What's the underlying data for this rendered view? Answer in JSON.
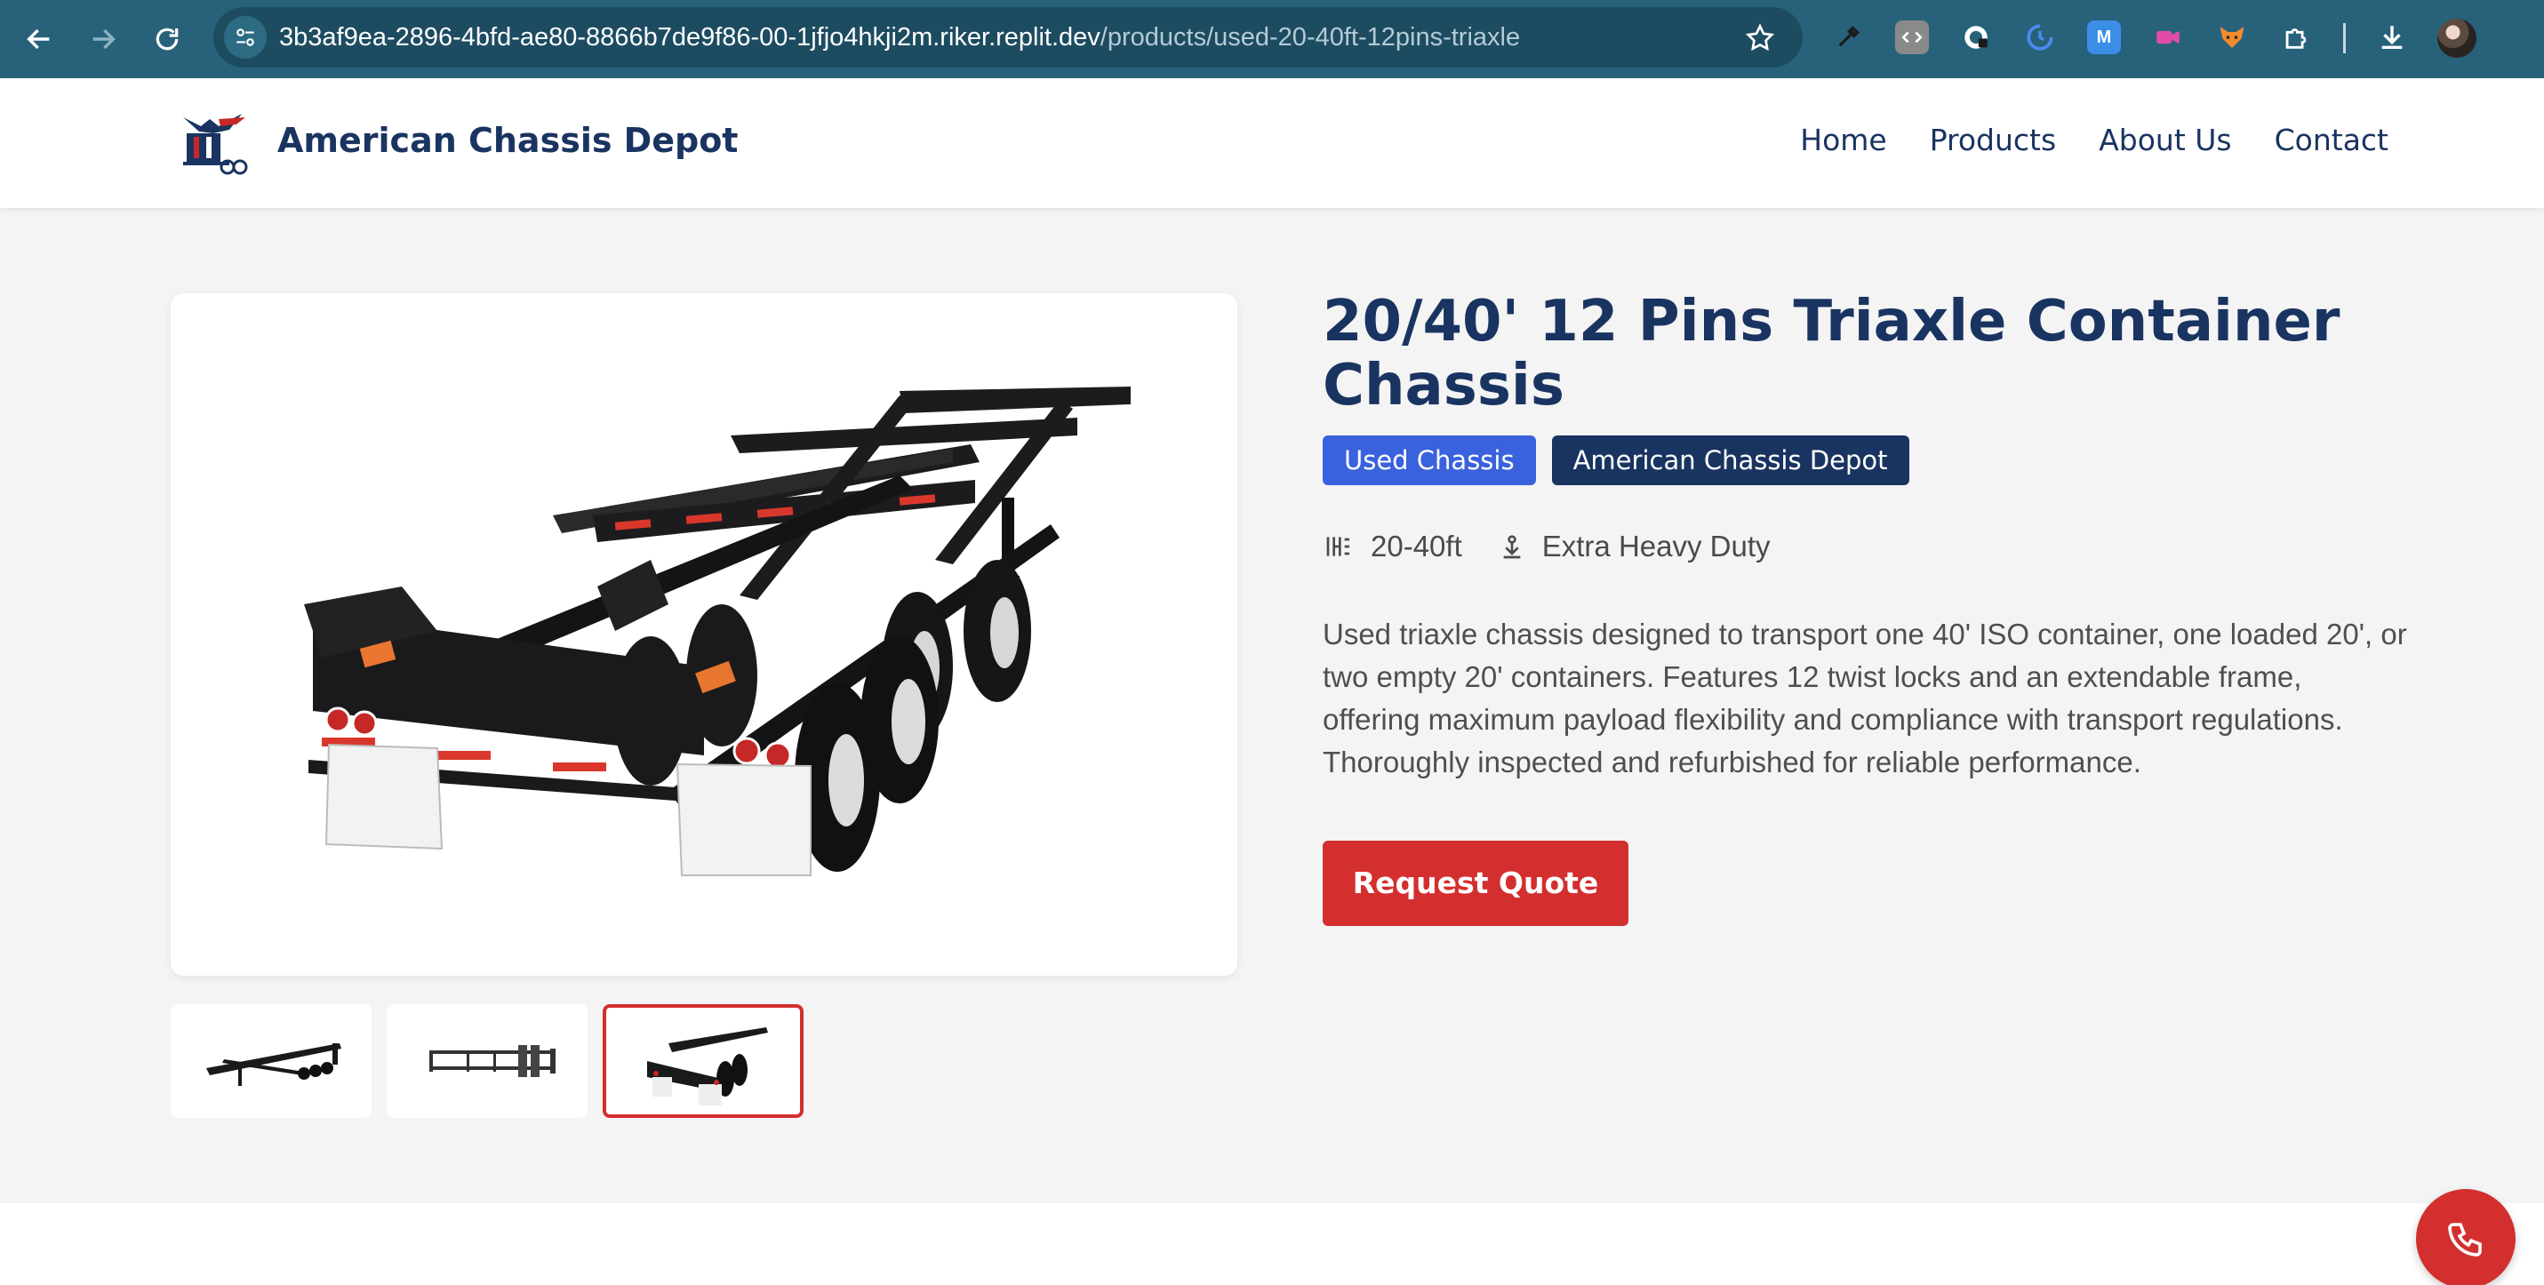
{
  "browser": {
    "url_host": "3b3af9ea-2896-4bfd-ae80-8866b7de9f86-00-1jfjo4hkji2m.riker.replit.dev",
    "url_path": "/products/used-20-40ft-12pins-triaxle",
    "extensions": [
      "eyedropper-icon",
      "code-icon",
      "privacy-icon",
      "clock-icon",
      "m-icon",
      "video-icon",
      "fox-icon",
      "puzzle-icon"
    ]
  },
  "site": {
    "brand": "American Chassis Depot",
    "nav": [
      "Home",
      "Products",
      "About Us",
      "Contact"
    ]
  },
  "product": {
    "title": "20/40' 12 Pins Triaxle Container Chassis",
    "badges": [
      "Used Chassis",
      "American Chassis Depot"
    ],
    "size": "20-40ft",
    "duty": "Extra Heavy Duty",
    "description": "Used triaxle chassis designed to transport one 40' ISO container, one loaded 20', or two empty 20' containers. Features 12 twist locks and an extendable frame, offering maximum payload flexibility and compliance with transport regulations. Thoroughly inspected and refurbished for reliable performance.",
    "cta": "Request Quote",
    "selected_thumbnail": 3
  },
  "colors": {
    "navy": "#1a3461",
    "blue_badge": "#3a62dd",
    "accent_red": "#d32f2f",
    "chrome": "#27627a"
  }
}
